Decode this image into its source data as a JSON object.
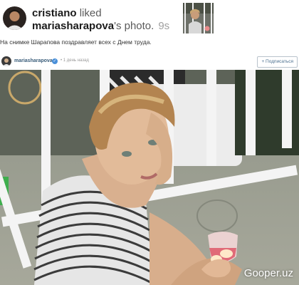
{
  "notification": {
    "actor": "cristiano",
    "action": " liked",
    "owner": "mariasharapova",
    "owner_suffix": "'s photo.",
    "time": "9s"
  },
  "caption": "На снимке Шарапова поздравляет всех с Днем труда.",
  "post": {
    "username": "mariasharapova",
    "verified_mark": "✓",
    "time_ago": "• 1 день назад",
    "follow_label": "+ Подписаться"
  },
  "photo": {
    "watermark": "Gooper.uz"
  },
  "colors": {
    "link": "#3a5d7a",
    "verified": "#4a90d9",
    "railing": "#f4f4f4"
  }
}
